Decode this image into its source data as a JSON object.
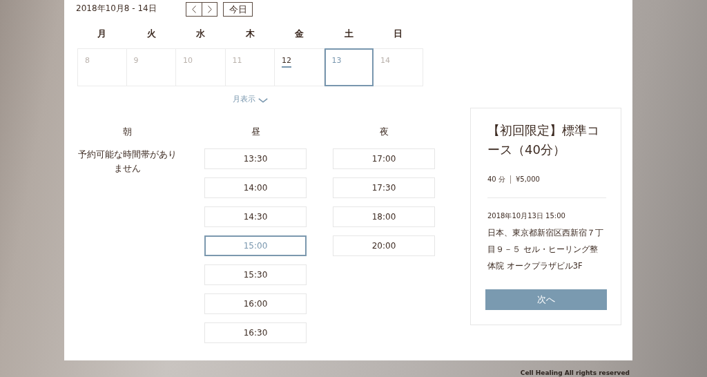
{
  "header": {
    "date_range": "2018年10月8 - 14日",
    "today_button": "今日"
  },
  "calendar": {
    "weekdays": [
      "月",
      "火",
      "水",
      "木",
      "金",
      "土",
      "日"
    ],
    "days": [
      {
        "date": "8",
        "selected": false,
        "today": false,
        "disabled": true
      },
      {
        "date": "9",
        "selected": false,
        "today": false,
        "disabled": true
      },
      {
        "date": "10",
        "selected": false,
        "today": false,
        "disabled": true
      },
      {
        "date": "11",
        "selected": false,
        "today": false,
        "disabled": true
      },
      {
        "date": "12",
        "selected": false,
        "today": true,
        "disabled": false
      },
      {
        "date": "13",
        "selected": true,
        "today": false,
        "disabled": false
      },
      {
        "date": "14",
        "selected": false,
        "today": false,
        "disabled": true
      }
    ],
    "view_toggle": "月表示"
  },
  "periods": [
    {
      "kind": "message",
      "label": "朝",
      "message": "予約可能な時間帯がありません"
    },
    {
      "kind": "slots",
      "label": "昼",
      "slots": [
        {
          "time": "13:30",
          "selected": false
        },
        {
          "time": "14:00",
          "selected": false
        },
        {
          "time": "14:30",
          "selected": false
        },
        {
          "time": "15:00",
          "selected": true
        },
        {
          "time": "15:30",
          "selected": false
        },
        {
          "time": "16:00",
          "selected": false
        },
        {
          "time": "16:30",
          "selected": false
        }
      ]
    },
    {
      "kind": "slots",
      "label": "夜",
      "slots": [
        {
          "time": "17:00",
          "selected": false
        },
        {
          "time": "17:30",
          "selected": false
        },
        {
          "time": "18:00",
          "selected": false
        },
        {
          "time": "20:00",
          "selected": false
        }
      ]
    }
  ],
  "summary": {
    "title": "【初回限定】標準コース（40分）",
    "duration": "40 分",
    "price": "¥5,000",
    "datetime": "2018年10月13日 15:00",
    "address": "日本、東京都新宿区西新宿７丁目９－５ セル・ヒーリング整体院 オークプラザビル3F",
    "next_button": "次へ"
  },
  "footer": {
    "copyright": "Cell Healing All rights reserved"
  }
}
